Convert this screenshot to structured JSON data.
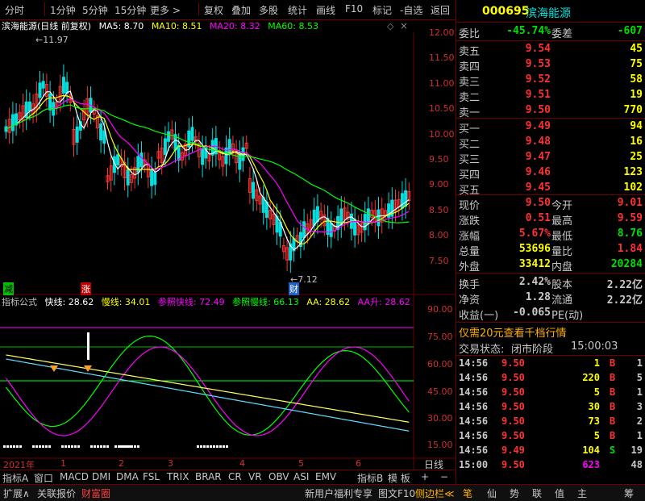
{
  "toolbar": {
    "items": [
      "分时",
      "1分钟",
      "5分钟",
      "15分钟",
      "更多 >",
      "复权",
      "叠加",
      "多股",
      "统计",
      "画线",
      "F10",
      "标记",
      "-自选",
      "返回"
    ]
  },
  "chart_header": {
    "title": "滨海能源(日线 前复权)",
    "ma5": "MA5: 8.70",
    "ma10": "MA10: 8.51",
    "ma20": "MA20: 8.32",
    "ma60": "MA60: 8.53"
  },
  "price_axis": [
    "12.00",
    "11.50",
    "11.00",
    "10.50",
    "10.00",
    "9.50",
    "9.00",
    "8.50",
    "8.00",
    "7.50"
  ],
  "price_annotations": {
    "high": "11.97",
    "low": "7.12",
    "jian": "减",
    "zhang": "涨",
    "cai": "财"
  },
  "indicator_header": {
    "name": "指标公式",
    "fast": "快线: 28.62",
    "slow": "慢线: 34.01",
    "ref_fast": "参照快线: 72.49",
    "ref_slow": "参照慢线: 66.13",
    "aa": "AA: 28.62",
    "aa_up": "AA升: 28.62"
  },
  "indicator_axis": [
    "90.00",
    "75.00",
    "60.00",
    "45.00",
    "30.00",
    "15.00"
  ],
  "time_axis": {
    "year": "2021年",
    "months": [
      "1",
      "2",
      "3",
      "4",
      "5",
      "6"
    ],
    "period": "日线"
  },
  "bottom_tabs": [
    "指标A",
    "窗口",
    "MACD",
    "DMI",
    "DMA",
    "FSL",
    "TRIX",
    "BRAR",
    "CR",
    "VR",
    "OBV",
    "ASI",
    "EMV",
    "指标B",
    "模 板",
    "+",
    "−"
  ],
  "status_bar": {
    "expand": "扩展∧",
    "link1": "关联报价",
    "link2": "财富圈",
    "promo": "新用户福利专享",
    "f10": "图文F10",
    "sidebar": "侧边栏≪",
    "buttons": [
      "笔",
      "仙",
      "势",
      "联",
      "值",
      "主",
      "筹"
    ]
  },
  "stock": {
    "code": "000695",
    "name": "滨海能源",
    "weibi_label": "委比",
    "weibi_value": "-45.74%",
    "weicha_label": "委差",
    "weicha_value": "-607"
  },
  "asks": [
    {
      "label": "卖五",
      "price": "9.54",
      "vol": "45"
    },
    {
      "label": "卖四",
      "price": "9.53",
      "vol": "75"
    },
    {
      "label": "卖三",
      "price": "9.52",
      "vol": "58"
    },
    {
      "label": "卖二",
      "price": "9.51",
      "vol": "19"
    },
    {
      "label": "卖一",
      "price": "9.50",
      "vol": "770"
    }
  ],
  "bids": [
    {
      "label": "买一",
      "price": "9.49",
      "vol": "94"
    },
    {
      "label": "买二",
      "price": "9.48",
      "vol": "16"
    },
    {
      "label": "买三",
      "price": "9.47",
      "vol": "25"
    },
    {
      "label": "买四",
      "price": "9.46",
      "vol": "123"
    },
    {
      "label": "买五",
      "price": "9.45",
      "vol": "102"
    }
  ],
  "quote": [
    {
      "l1": "现价",
      "v1": "9.50",
      "l2": "今开",
      "v2": "9.01"
    },
    {
      "l1": "涨跌",
      "v1": "0.51",
      "l2": "最高",
      "v2": "9.59"
    },
    {
      "l1": "涨幅",
      "v1": "5.67%",
      "l2": "最低",
      "v2": "8.76"
    },
    {
      "l1": "总量",
      "v1": "53696",
      "l2": "量比",
      "v2": "1.84"
    },
    {
      "l1": "外盘",
      "v1": "33412",
      "l2": "内盘",
      "v2": "20284"
    }
  ],
  "quote2": [
    {
      "l1": "换手",
      "v1": "2.42%",
      "l2": "股本",
      "v2": "2.22亿"
    },
    {
      "l1": "净资",
      "v1": "1.28",
      "l2": "流通",
      "v2": "2.22亿"
    },
    {
      "l1": "收益(一)",
      "v1": "-0.065",
      "l2": "PE(动)",
      "v2": ""
    }
  ],
  "promo_line": "仅需20元查看千档行情",
  "trade_status": {
    "label": "交易状态:",
    "value": "闭市阶段",
    "time": "15:00:03"
  },
  "ticks": [
    {
      "time": "14:56",
      "price": "9.50",
      "vol": "1",
      "side": "B",
      "n": "1"
    },
    {
      "time": "14:56",
      "price": "9.50",
      "vol": "220",
      "side": "B",
      "n": "5"
    },
    {
      "time": "14:56",
      "price": "9.50",
      "vol": "5",
      "side": "B",
      "n": "1"
    },
    {
      "time": "14:56",
      "price": "9.50",
      "vol": "30",
      "side": "B",
      "n": "3"
    },
    {
      "time": "14:56",
      "price": "9.50",
      "vol": "73",
      "side": "B",
      "n": "2"
    },
    {
      "time": "14:56",
      "price": "9.50",
      "vol": "5",
      "side": "B",
      "n": "1"
    },
    {
      "time": "14:56",
      "price": "9.49",
      "vol": "104",
      "side": "S",
      "n": "19"
    },
    {
      "time": "15:00",
      "price": "9.50",
      "vol": "623",
      "side": "",
      "n": "48"
    }
  ],
  "colors": {
    "up": "#ff3232",
    "down": "#00e0e0",
    "ma5": "#ffffff",
    "ma10": "#ffff00",
    "ma20": "#ff00ff",
    "ma60": "#00ff00",
    "bg": "#000000",
    "grid": "#6a0000"
  }
}
